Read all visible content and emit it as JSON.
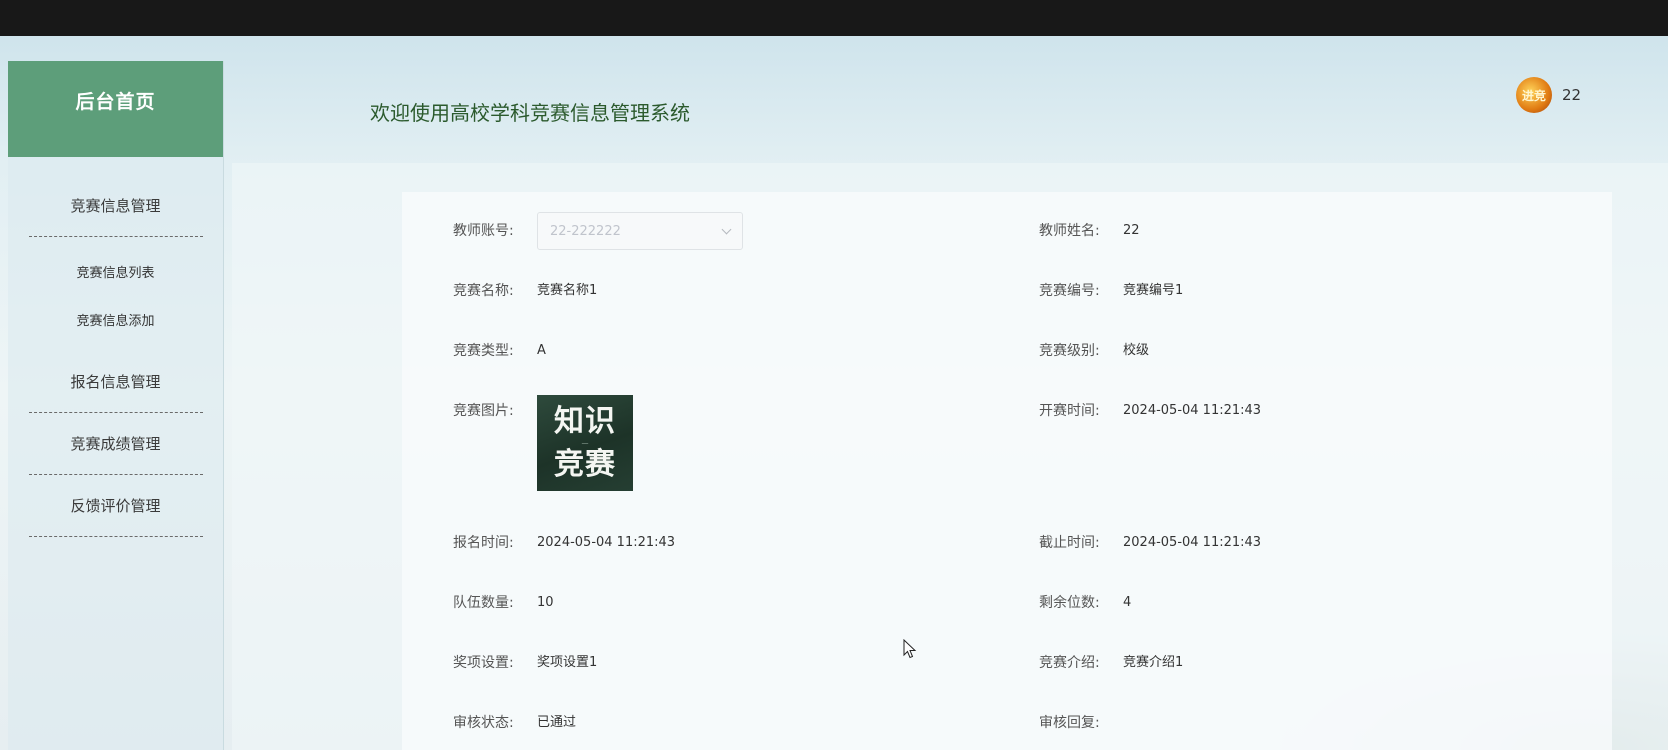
{
  "sidebar": {
    "title": "后台首页",
    "menu": [
      {
        "label": "竞赛信息管理",
        "children": [
          "竞赛信息列表",
          "竞赛信息添加"
        ]
      },
      {
        "label": "报名信息管理"
      },
      {
        "label": "竞赛成绩管理"
      },
      {
        "label": "反馈评价管理"
      }
    ]
  },
  "header": {
    "title": "欢迎使用高校学科竞赛信息管理系统",
    "user": {
      "avatar_icon": "avatar-image",
      "avatar_text": "进竞",
      "name": "22"
    }
  },
  "form": {
    "teacher_account": {
      "label": "教师账号:",
      "placeholder": "22-222222"
    },
    "teacher_name": {
      "label": "教师姓名:",
      "value": "22"
    },
    "comp_name": {
      "label": "竞赛名称:",
      "value": "竞赛名称1"
    },
    "comp_no": {
      "label": "竞赛编号:",
      "value": "竞赛编号1"
    },
    "comp_type": {
      "label": "竞赛类型:",
      "value": "A"
    },
    "comp_level": {
      "label": "竞赛级别:",
      "value": "校级"
    },
    "comp_image": {
      "label": "竞赛图片:",
      "line1": "知识",
      "line2": "竞赛"
    },
    "start_time": {
      "label": "开赛时间:",
      "value": "2024-05-04 11:21:43"
    },
    "signup_time": {
      "label": "报名时间:",
      "value": "2024-05-04 11:21:43"
    },
    "deadline": {
      "label": "截止时间:",
      "value": "2024-05-04 11:21:43"
    },
    "team_count": {
      "label": "队伍数量:",
      "value": "10"
    },
    "remaining": {
      "label": "剩余位数:",
      "value": "4"
    },
    "awards": {
      "label": "奖项设置:",
      "value": "奖项设置1"
    },
    "intro": {
      "label": "竞赛介绍:",
      "value": "竞赛介绍1"
    },
    "review_status": {
      "label": "审核状态:",
      "value": "已通过"
    },
    "review_reply": {
      "label": "审核回复:",
      "value": ""
    }
  },
  "colors": {
    "topbar": "#181818",
    "sidebar_header": "#5d9e7a",
    "title_text": "#2b5a2d"
  }
}
